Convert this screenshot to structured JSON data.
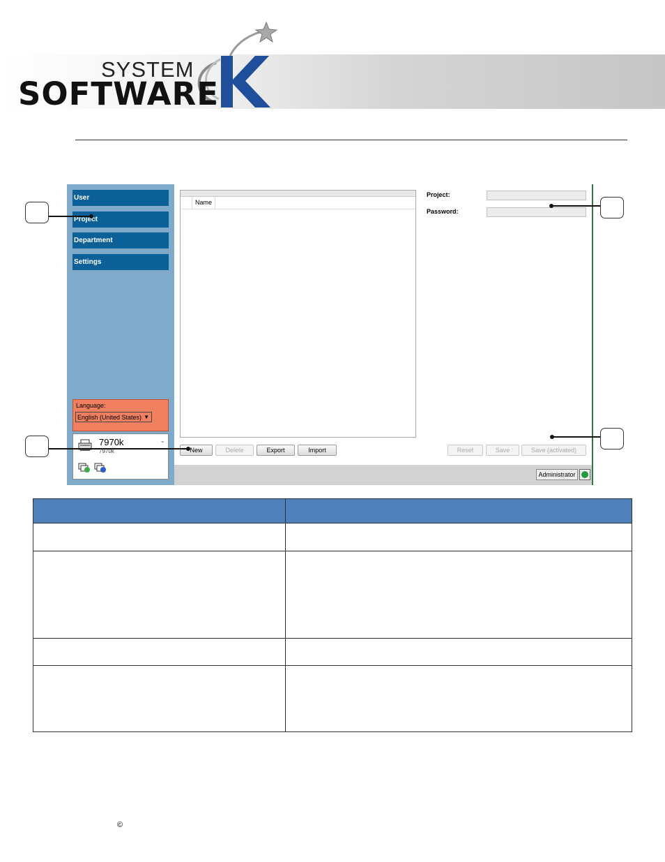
{
  "header": {
    "logo_line1": "SYSTEM",
    "logo_line2": "SOFTWARE",
    "logo_letter": "K",
    "brand_color": "#1f4f9a"
  },
  "app": {
    "sidebar": {
      "items": [
        {
          "label": "User"
        },
        {
          "label": "Project"
        },
        {
          "label": "Department"
        },
        {
          "label": "Settings"
        }
      ],
      "language": {
        "label": "Language:",
        "value": "English (United States)"
      },
      "device": {
        "name": "7970k",
        "subtitle": "7970k"
      }
    },
    "list": {
      "column_header": "Name"
    },
    "buttons": {
      "new": "New",
      "delete": "Delete",
      "export": "Export",
      "import": "Import",
      "reset": "Reset",
      "save": "Save",
      "save_activated": "Save (activated)"
    },
    "form": {
      "project_label": "Project:",
      "password_label": "Password:"
    },
    "status": {
      "user": "Administrator",
      "led_color": "#1f9d3a"
    }
  },
  "table": {
    "header": [
      "",
      ""
    ],
    "rows": [
      [
        "",
        ""
      ],
      [
        "",
        ""
      ],
      [
        "",
        ""
      ],
      [
        "",
        ""
      ]
    ],
    "header_color": "#4f81bd"
  },
  "footer": {
    "copyright": "©"
  }
}
